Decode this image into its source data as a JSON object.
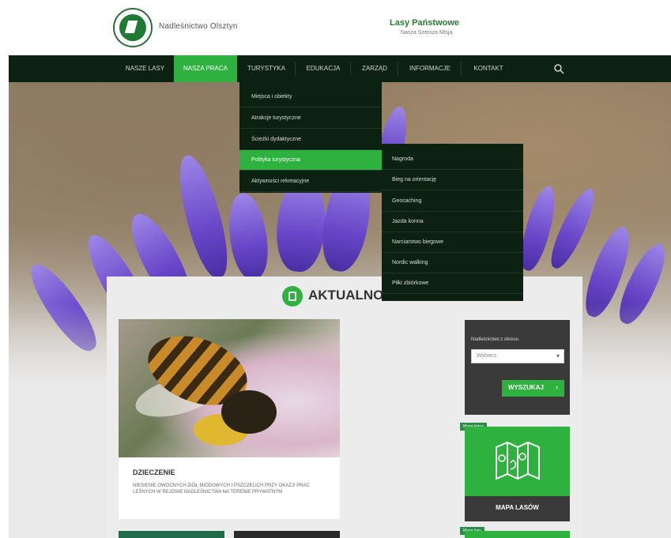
{
  "header": {
    "site_name": "Nadleśnictwo Olsztyn",
    "brand": "Lasy Państwowe",
    "brand_sub": "Nasza Szersza Misja"
  },
  "nav": {
    "items": [
      {
        "label": "NASZE LASY",
        "active": false
      },
      {
        "label": "NASZA PRACA",
        "active": true
      },
      {
        "label": "TURYSTYKA",
        "active": false
      },
      {
        "label": "EDUKACJA",
        "active": false
      },
      {
        "label": "ZARZĄD",
        "active": false
      },
      {
        "label": "INFORMACJE",
        "active": false
      },
      {
        "label": "KONTAKT",
        "active": false
      }
    ],
    "search_icon": "search-icon"
  },
  "dropdown_primary": {
    "items": [
      {
        "label": "Miejsca i obiekty",
        "active": false
      },
      {
        "label": "Atrakcje turystyczne",
        "active": false
      },
      {
        "label": "Ścieżki dydaktyczne",
        "active": false
      },
      {
        "label": "Polityka turystyczna",
        "active": true
      },
      {
        "label": "Aktywności rekreacyjne",
        "active": false
      }
    ]
  },
  "dropdown_secondary": {
    "items": [
      {
        "label": "Nagroda"
      },
      {
        "label": "Bieg na orientację"
      },
      {
        "label": "Geocaching"
      },
      {
        "label": "Jazda konna"
      },
      {
        "label": "Narciarstwo biegowe"
      },
      {
        "label": "Nordic walking"
      },
      {
        "label": "Piłki zbiórkowe"
      }
    ]
  },
  "news": {
    "section_title": "AKTUALNOŚCI",
    "card": {
      "title": "DZIECZENIE",
      "text": "NIESIENIE OWOCNYCH ZIÓŁ MIODOWYCH I PSZCZELICH PRZY OKAZJI PRAC LEŚNYCH W REJONIE NADLEŚNICTWA NA TERENIE PRYWATNYM"
    }
  },
  "widget": {
    "label": "Nadleśnictwo z okresu",
    "select_value": "Wybierz",
    "button_label": "WYSZUKAJ",
    "button_arrow": "›"
  },
  "map_widget": {
    "tag": "Mapa leśna",
    "label": "MAPA LASÓW"
  },
  "map_widget2": {
    "tag": "Mapa lasu"
  },
  "colors": {
    "nav_bg": "#0d2113",
    "accent_green": "#2fb13f",
    "widget_dark": "#3a3a3a",
    "content_bg": "#ececec"
  }
}
